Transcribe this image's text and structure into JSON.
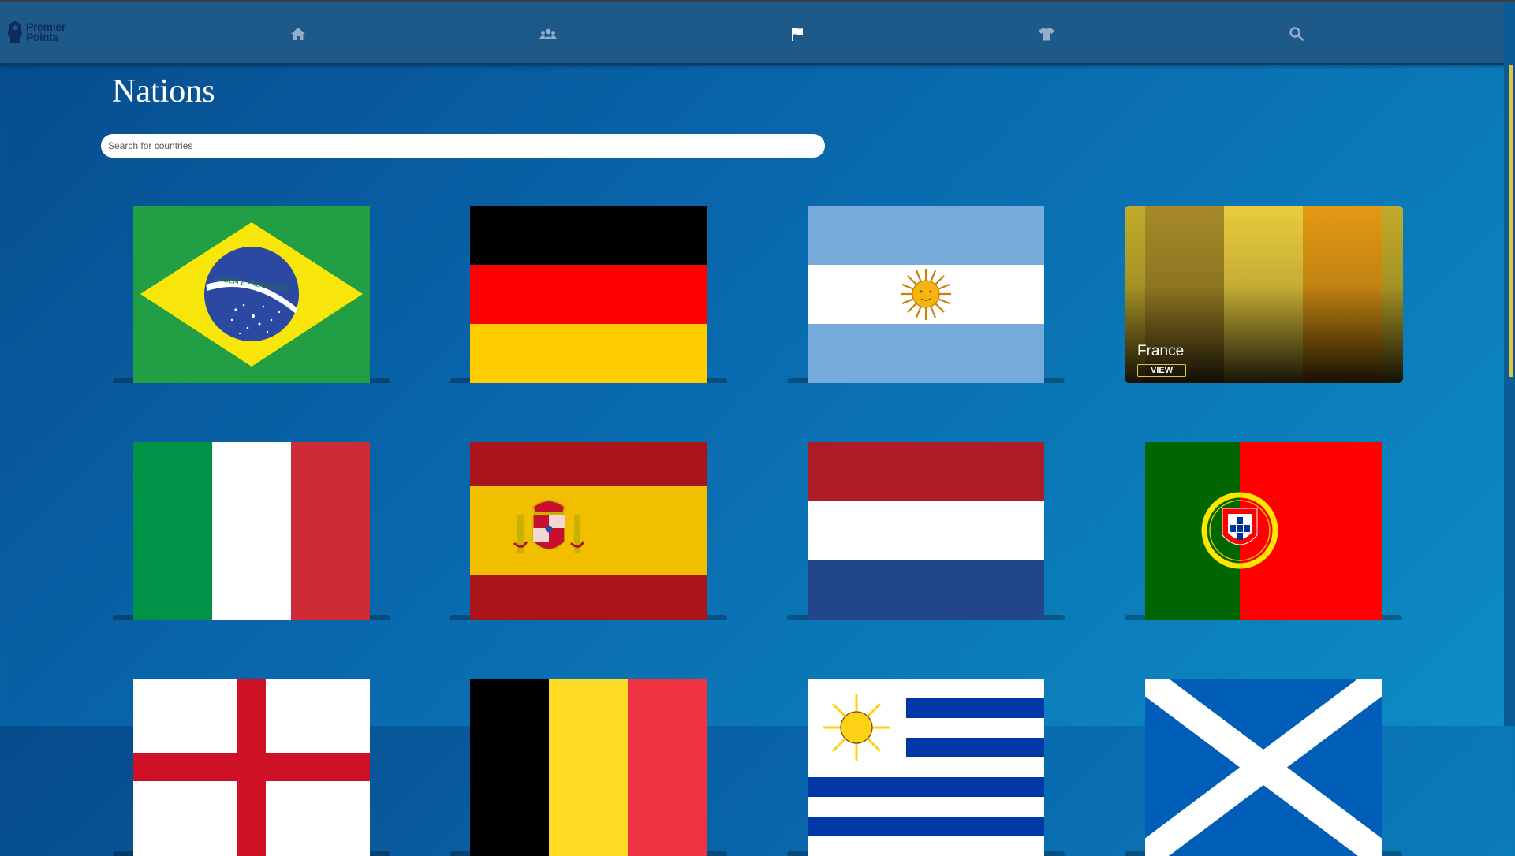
{
  "app": {
    "logo_line1": "Premier",
    "logo_line2": "Points"
  },
  "nav": {
    "items": [
      {
        "icon": "home-icon"
      },
      {
        "icon": "users-icon"
      },
      {
        "icon": "flag-icon",
        "active": true
      },
      {
        "icon": "shirt-icon"
      },
      {
        "icon": "search-icon"
      }
    ]
  },
  "page": {
    "title": "Nations"
  },
  "search": {
    "placeholder": "Search for countries",
    "value": ""
  },
  "nations": {
    "items": [
      {
        "flag": "brazil-flag",
        "motto": "ORDEM E PROGRESSO"
      },
      {
        "flag": "germany-flag"
      },
      {
        "flag": "argentina-flag"
      },
      {
        "flag": "france-flag",
        "name": "France",
        "button": "VIEW",
        "hovered": true
      },
      {
        "flag": "italy-flag"
      },
      {
        "flag": "spain-flag"
      },
      {
        "flag": "netherlands-flag"
      },
      {
        "flag": "portugal-flag"
      },
      {
        "flag": "england-flag"
      },
      {
        "flag": "belgium-flag"
      },
      {
        "flag": "uruguay-flag"
      },
      {
        "flag": "scotland-flag"
      }
    ]
  },
  "colors": {
    "accent": "#e4c445",
    "navbar": "#1d5a8a",
    "background": "#0969ae"
  }
}
